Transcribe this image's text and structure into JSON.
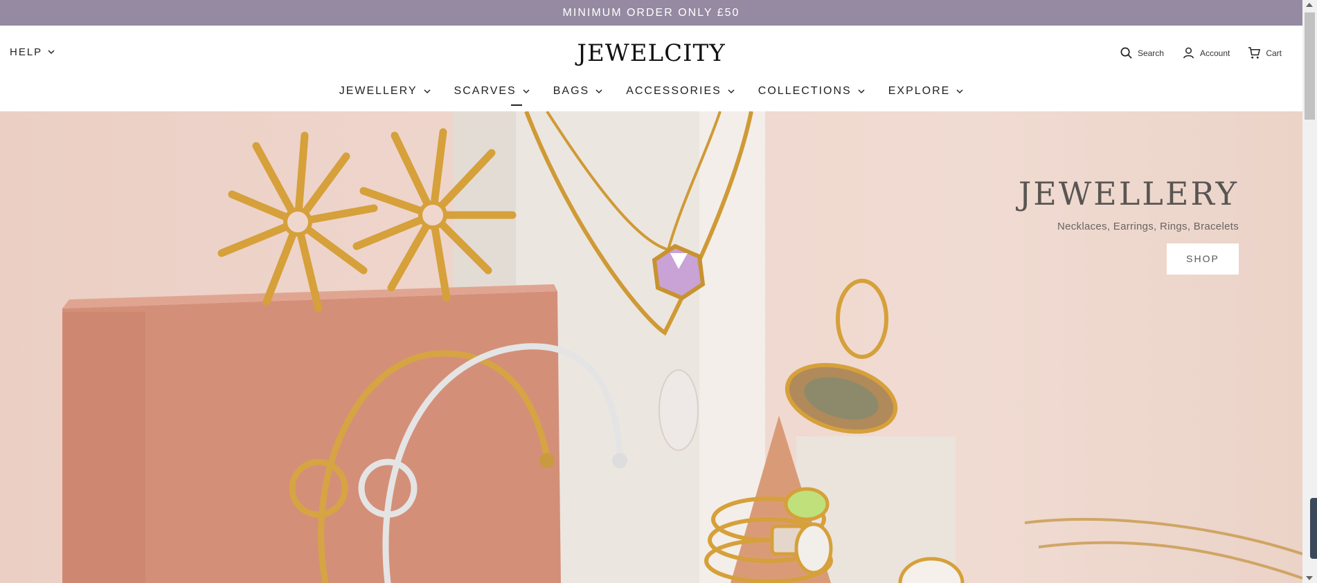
{
  "announcement": "MINIMUM ORDER ONLY £50",
  "header": {
    "help_label": "HELP",
    "logo": "JEWELCITY",
    "utils": {
      "search": "Search",
      "account": "Account",
      "cart": "Cart"
    }
  },
  "nav": {
    "items": [
      {
        "label": "JEWELLERY"
      },
      {
        "label": "SCARVES"
      },
      {
        "label": "BAGS"
      },
      {
        "label": "ACCESSORIES"
      },
      {
        "label": "COLLECTIONS"
      },
      {
        "label": "EXPLORE"
      }
    ]
  },
  "hero": {
    "title": "JEWELLERY",
    "subtitle": "Necklaces, Earrings, Rings, Bracelets",
    "button": "SHOP"
  },
  "colors": {
    "announcement_bg": "#958aa1",
    "hero_bg": "#efd7cd",
    "gold": "#d9a23a",
    "silver": "#e6e6e6",
    "block": "#d68d77"
  },
  "icons": [
    "chevron-down-icon",
    "search-icon",
    "user-icon",
    "cart-icon"
  ]
}
